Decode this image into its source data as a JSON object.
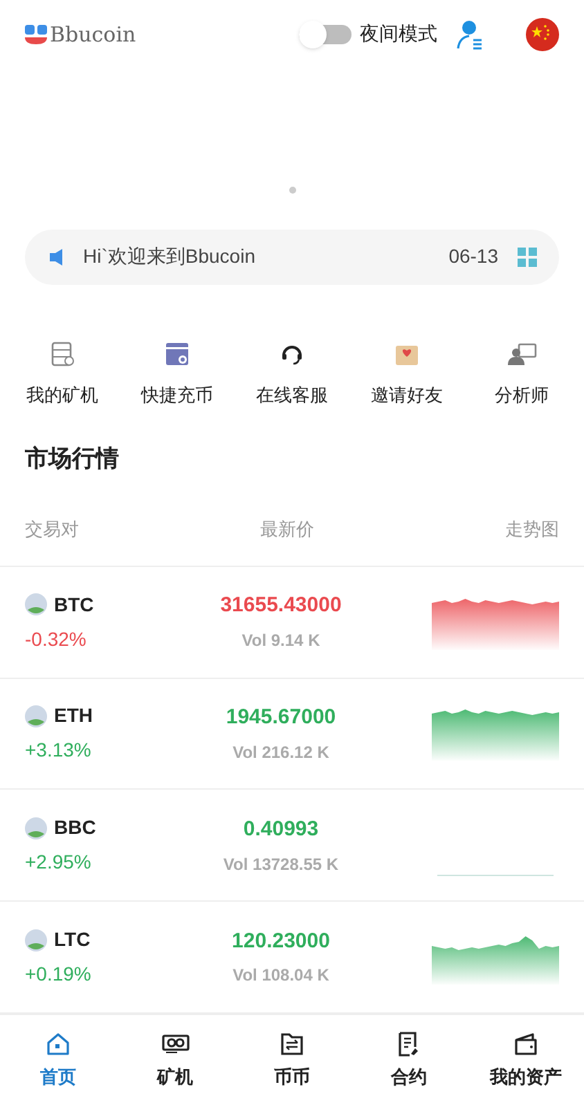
{
  "header": {
    "logo": "Bbucoin",
    "night_mode": {
      "label": "夜间模式",
      "on": false
    }
  },
  "notice": {
    "text": "Hi`欢迎来到Bbucoin",
    "date": "06-13"
  },
  "quick_menu": [
    {
      "kind": "miner",
      "label": "我的矿机"
    },
    {
      "kind": "deposit",
      "label": "快捷充币"
    },
    {
      "kind": "support",
      "label": "在线客服"
    },
    {
      "kind": "invite",
      "label": "邀请好友"
    },
    {
      "kind": "analyst",
      "label": "分析师"
    }
  ],
  "market": {
    "title": "市场行情",
    "columns": [
      "交易对",
      "最新价",
      "走势图"
    ],
    "rows": [
      {
        "symbol": "BTC",
        "change": "-0.32%",
        "price": "31655.43000",
        "volume": "Vol 9.14 K",
        "rising": false,
        "kind": "wavy"
      },
      {
        "symbol": "ETH",
        "change": "+3.13%",
        "price": "1945.67000",
        "volume": "Vol 216.12 K",
        "rising": true,
        "kind": "wavy"
      },
      {
        "symbol": "BBC",
        "change": "+2.95%",
        "price": "0.40993",
        "volume": "Vol 13728.55 K",
        "rising": true,
        "kind": "flat"
      },
      {
        "symbol": "LTC",
        "change": "+0.19%",
        "price": "120.23000",
        "volume": "Vol 108.04 K",
        "rising": true,
        "kind": "bump"
      }
    ]
  },
  "tab_bar": [
    {
      "kind": "home",
      "label": "首页",
      "selected": true
    },
    {
      "kind": "miner",
      "label": "矿机",
      "selected": false
    },
    {
      "kind": "exchange",
      "label": "币币",
      "selected": false
    },
    {
      "kind": "contract",
      "label": "合约",
      "selected": false
    },
    {
      "kind": "wallet",
      "label": "我的资产",
      "selected": false
    }
  ]
}
